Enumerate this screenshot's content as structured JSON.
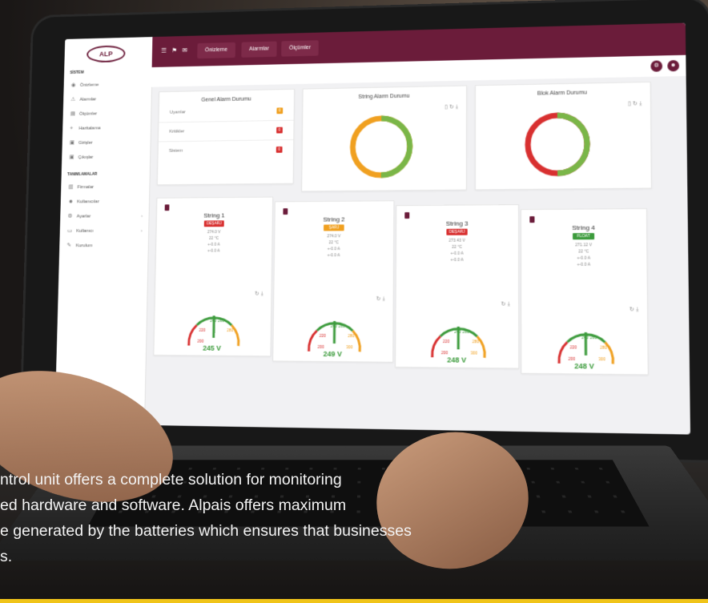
{
  "app": {
    "logo_text": "ALP",
    "tabs": [
      "Önizleme",
      "Alarmlar",
      "Ölçümler"
    ],
    "user_icons": [
      "settings-icon",
      "user-icon"
    ]
  },
  "sidebar": {
    "section1": "SİSTEM",
    "items1": [
      {
        "label": "Önizleme",
        "icon": "eye-icon"
      },
      {
        "label": "Alarmlar",
        "icon": "alarm-icon"
      },
      {
        "label": "Ölçümler",
        "icon": "measure-icon"
      },
      {
        "label": "Haritalama",
        "icon": "map-icon"
      },
      {
        "label": "Girişler",
        "icon": "input-icon"
      },
      {
        "label": "Çıkışlar",
        "icon": "output-icon"
      }
    ],
    "section2": "TANIMLAMALAR",
    "items2": [
      {
        "label": "Firmalar",
        "icon": "chart-icon"
      },
      {
        "label": "Kullanıcılar",
        "icon": "users-icon"
      },
      {
        "label": "Ayarlar",
        "icon": "gear-icon"
      },
      {
        "label": "Kullanıcı",
        "icon": "card-icon"
      },
      {
        "label": "Kurulum",
        "icon": "tool-icon"
      }
    ]
  },
  "general_alarm": {
    "title": "Genel Alarm Durumu",
    "rows": [
      {
        "label": "Uyarılar",
        "value": "0",
        "color": "#f0a020"
      },
      {
        "label": "Kritikler",
        "value": "0",
        "color": "#d83030"
      },
      {
        "label": "Sistem",
        "value": "0",
        "color": "#d83030"
      }
    ]
  },
  "string_alarm": {
    "title": "String Alarm Durumu",
    "segments": [
      {
        "color": "#7ab648",
        "fraction": 0.5
      },
      {
        "color": "#f0a020",
        "fraction": 0.5
      }
    ]
  },
  "block_alarm": {
    "title": "Blok Alarm Durumu",
    "segments": [
      {
        "color": "#7ab648",
        "fraction": 0.5
      },
      {
        "color": "#d83030",
        "fraction": 0.5
      }
    ]
  },
  "strings": [
    {
      "name": "String 1",
      "state": "DEŞARJ",
      "state_color": "#d83030",
      "voltage": "274.0 V",
      "temp": "22 °C",
      "current1": "+-0.0 A",
      "current2": "+-0.0 A",
      "gauge_value": "245 V",
      "gauge_ticks": [
        "220",
        "240",
        "260",
        "280",
        "200"
      ]
    },
    {
      "name": "String 2",
      "state": "ŞARJ",
      "state_color": "#f0a020",
      "voltage": "274.0 V",
      "temp": "22 °C",
      "current1": "+-0.0 A",
      "current2": "+-0.0 A",
      "gauge_value": "249 V",
      "gauge_ticks": [
        "220",
        "240",
        "260",
        "280",
        "200",
        "300"
      ]
    },
    {
      "name": "String 3",
      "state": "DEŞARJ",
      "state_color": "#d83030",
      "voltage": "273.43 V",
      "temp": "22 °C",
      "current1": "+-0.0 A",
      "current2": "+-0.0 A",
      "gauge_value": "248 V",
      "gauge_ticks": [
        "220",
        "240",
        "260",
        "280",
        "200",
        "300"
      ]
    },
    {
      "name": "String 4",
      "state": "FLOAT",
      "state_color": "#3c9b3c",
      "voltage": "271.12 V",
      "temp": "22 °C",
      "current1": "+-0.0 A",
      "current2": "+-0.0 A",
      "gauge_value": "248 V",
      "gauge_ticks": [
        "220",
        "240",
        "260",
        "280",
        "200",
        "300"
      ]
    }
  ],
  "caption": {
    "line1": "ntrol unit offers a complete solution for monitoring",
    "line2": "ed hardware and software. Alpais offers maximum",
    "line3": "e generated by the batteries which ensures that businesses",
    "line4": "s."
  },
  "accent": "#6b1c3a"
}
